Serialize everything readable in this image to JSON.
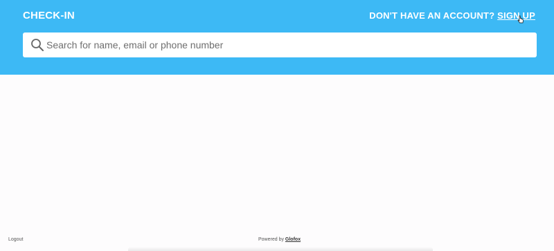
{
  "header": {
    "title": "CHECK-IN",
    "signup_prompt": "DON'T HAVE AN ACCOUNT?",
    "signup_link": "SIGN UP",
    "background_color": "#3db9f5"
  },
  "search": {
    "placeholder": "Search for name, email or phone number",
    "value": "",
    "icon": "search-icon"
  },
  "footer": {
    "logout_label": "Logout",
    "powered_by_label": "Powered by",
    "brand_label": "Glofox"
  }
}
